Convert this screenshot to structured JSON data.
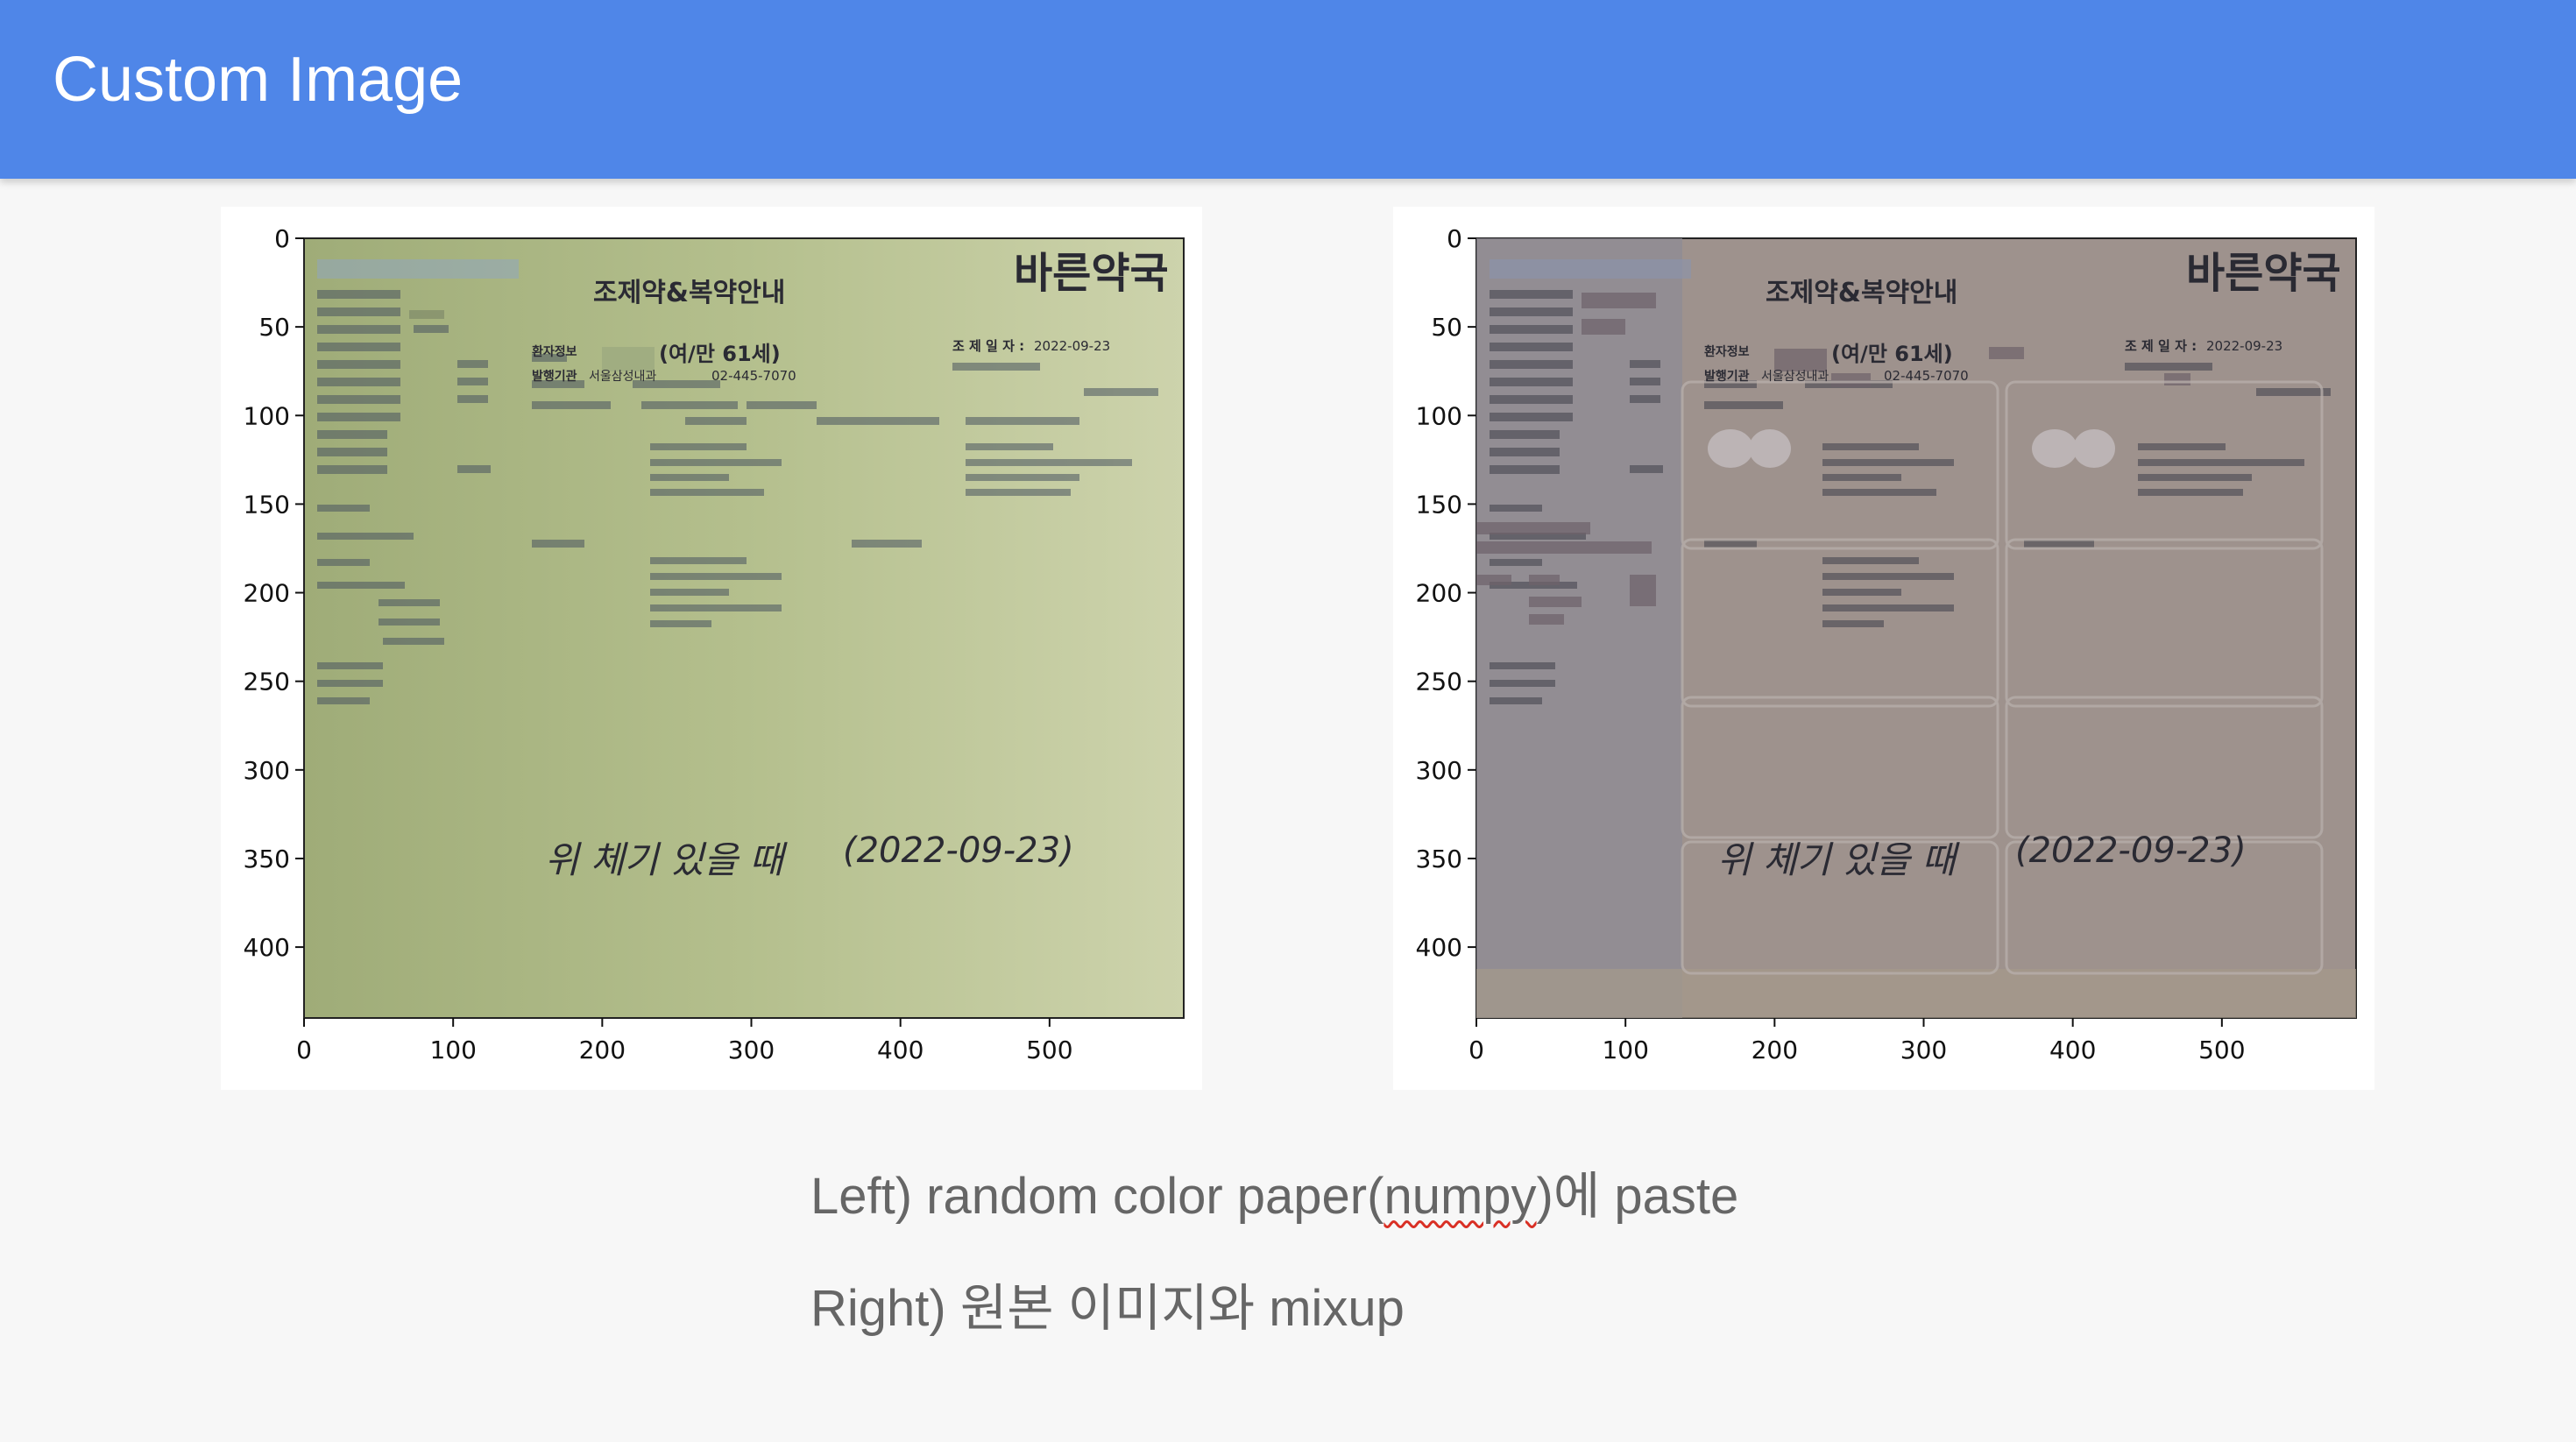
{
  "header": {
    "title": "Custom Image"
  },
  "panels": [
    {
      "id": "left",
      "doc": {
        "pharmacy": "바른약국",
        "heading": "조제약&복약안내",
        "date_label": "조 제 일 자 :",
        "date_value": "2022-09-23",
        "patient_label": "환자정보",
        "patient_age": "(여/만 61세)",
        "issuer_label": "발행기관",
        "issuer_value": "서울삼성내과",
        "phone": "02-445-7070",
        "handwriting_1": "위 체기 있을 때",
        "handwriting_2": "(2022-09-23)"
      }
    },
    {
      "id": "right",
      "doc": {
        "pharmacy": "바른약국",
        "heading": "조제약&복약안내",
        "date_label": "조 제 일 자 :",
        "date_value": "2022-09-23",
        "patient_label": "환자정보",
        "patient_age": "(여/만 61세)",
        "issuer_label": "발행기관",
        "issuer_value": "서울삼성내과",
        "phone": "02-445-7070",
        "handwriting_1": "위 체기 있을 때",
        "handwriting_2": "(2022-09-23)"
      }
    }
  ],
  "axes": {
    "y_ticks": [
      "0",
      "50",
      "100",
      "150",
      "200",
      "250",
      "300",
      "350",
      "400"
    ],
    "x_ticks": [
      "0",
      "100",
      "200",
      "300",
      "400",
      "500"
    ]
  },
  "captions": {
    "line1_prefix": "Left) random color paper(",
    "line1_word": "numpy",
    "line1_suffix": ")에 paste",
    "line2": "Right) 원본 이미지와 mixup"
  },
  "colors": {
    "header": "#4f86e8",
    "left_paper": "#b9c496",
    "right_paper": "#9b8f8b"
  }
}
